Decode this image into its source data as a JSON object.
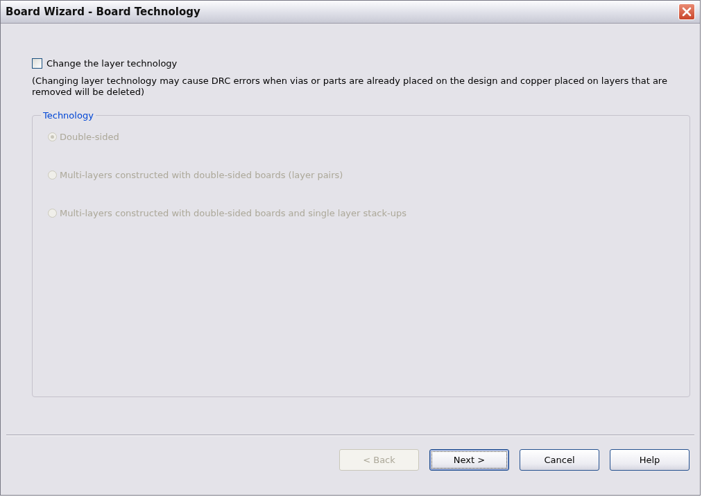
{
  "window": {
    "title": "Board Wizard - Board Technology"
  },
  "change_option": {
    "label": "Change the layer technology",
    "checked": false
  },
  "note": "(Changing layer technology may cause DRC errors when vias or parts are already placed on the design and copper placed on layers that are removed will be deleted)",
  "technology": {
    "title": "Technology",
    "disabled": true,
    "options": [
      {
        "label": "Double-sided",
        "selected": true
      },
      {
        "label": "Multi-layers constructed with double-sided boards (layer pairs)",
        "selected": false
      },
      {
        "label": "Multi-layers constructed with double-sided boards and single layer stack-ups",
        "selected": false
      }
    ]
  },
  "buttons": [
    {
      "label": "< Back",
      "disabled": true,
      "default": false
    },
    {
      "label": "Next >",
      "disabled": false,
      "default": true
    },
    {
      "label": "Cancel",
      "disabled": false,
      "default": false
    },
    {
      "label": "Help",
      "disabled": false,
      "default": false
    }
  ]
}
